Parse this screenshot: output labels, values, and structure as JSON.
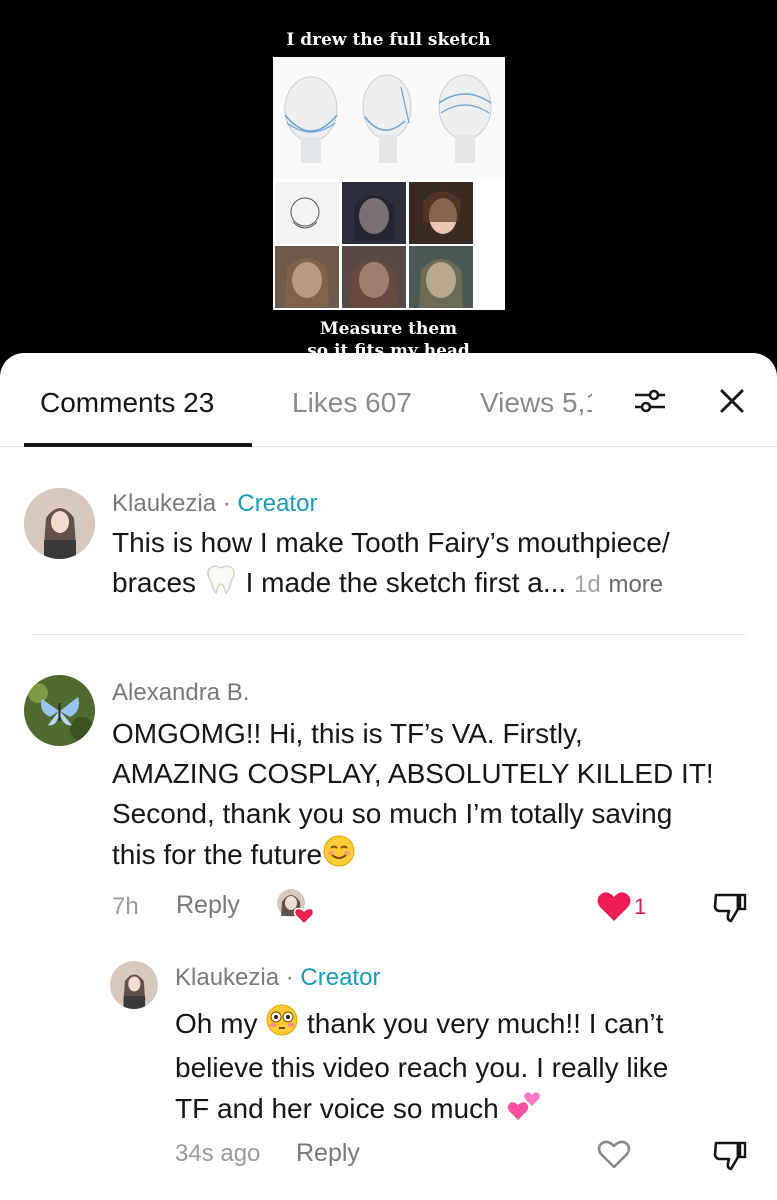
{
  "video": {
    "caption_top": "I drew the full sketch",
    "caption_bottom": "Measure them",
    "caption_bottom_2": "so it fits my head"
  },
  "tabs": {
    "comments": "Comments 23",
    "likes": "Likes 607",
    "views": "Views 5,1"
  },
  "icons": {
    "filter": "sliders-icon",
    "close": "close-icon"
  },
  "comments": [
    {
      "author": "Klaukezia",
      "separator": "·",
      "badge": "Creator",
      "text_line1": "This is how I make Tooth Fairy’s mouthpiece/",
      "text_line2_a": "braces",
      "text_line2_b": "I made the sketch first a...",
      "time": "1d",
      "more": "more"
    },
    {
      "author": "Alexandra B.",
      "text_lines": [
        "OMGOMG!! Hi, this is TF’s VA. Firstly,",
        "AMAZING COSPLAY, ABSOLUTELY KILLED IT!",
        "Second, thank you so much I’m totally saving",
        "this for the future"
      ],
      "time": "7h",
      "reply_label": "Reply",
      "like_count": "1"
    },
    {
      "author": "Klaukezia",
      "separator": "·",
      "badge": "Creator",
      "line1_a": "Oh my",
      "line1_b": "thank you very much!! I can’t",
      "line2": "believe this video reach you. I really like",
      "line3": "TF and her voice so much",
      "time": "34s ago",
      "reply_label": "Reply"
    }
  ],
  "colors": {
    "creator": "#1a9bb8",
    "heart": "#ee1d52",
    "text": "#161616",
    "muted": "#7a7a7a"
  }
}
